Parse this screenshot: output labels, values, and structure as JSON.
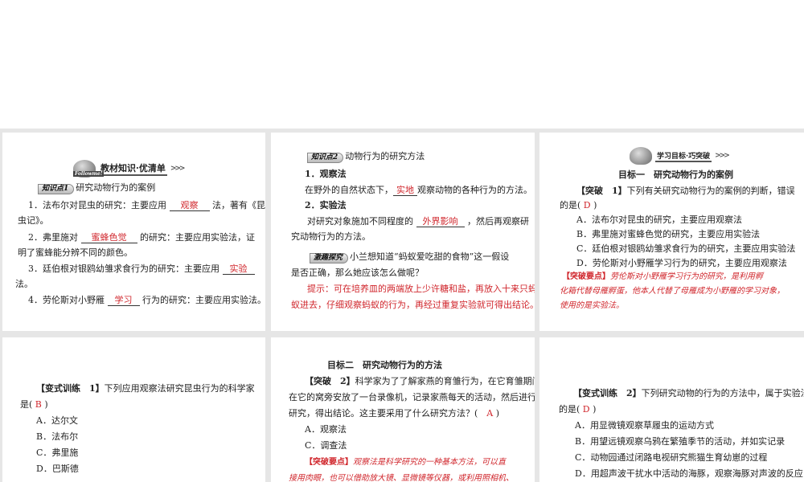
{
  "panel1": {
    "banner_title": "教材知识·优清单",
    "banner_tag": "Followme!",
    "kp_badge": "知识点1",
    "kp_title": "研究动物行为的案例",
    "items": [
      {
        "pre": "1．法布尔对昆虫的研究：主要应用",
        "answer": "观察",
        "post": "法，著有《昆",
        "cont": "虫记》。"
      },
      {
        "pre": "2．弗里施对",
        "answer": "蜜蜂色觉",
        "post": "的研究：主要应用实验法，证",
        "cont": "明了蜜蜂能分辨不同的颜色。"
      },
      {
        "pre": "3．廷伯根对银鸥幼雏求食行为的研究：主要应用",
        "answer": "实验",
        "post": "",
        "cont": "法。"
      },
      {
        "pre": "4．劳伦斯对小野雁",
        "answer": "学习",
        "post": "行为的研究：主要应用实验法。",
        "cont": ""
      }
    ]
  },
  "panel2": {
    "kp_badge": "知识点2",
    "kp_title": "动物行为的研究方法",
    "m1_title": "1．观察法",
    "m1_pre": "在野外的自然状态下，",
    "m1_answer": "实地",
    "m1_post": "观察动物的各种行为的方法。",
    "m2_title": "2．实验法",
    "m2_pre": "对研究对象施加不同程度的",
    "m2_answer": "外界影响",
    "m2_post": "，然后再观察研",
    "m2_cont": "究动物行为的方法。",
    "fun_badge": "激趣探究",
    "fun_q1": "小兰想知道“蚂蚁爱吃甜的食物”这一假设",
    "fun_q2": "是否正确，那么她应该怎么做呢？",
    "hint1": "提示：可在培养皿的两端放上少许糖和盐，再放入十来只蚂",
    "hint2": "蚁进去，仔细观察蚂蚁的行为，再经过重复实验就可得出结论。"
  },
  "panel3": {
    "banner_title": "学习目标·巧突破",
    "goal_title": "目标一　研究动物行为的案例",
    "q_label": "【突破　1】",
    "q1": "下列有关研究动物行为的案例的判断，错误",
    "q2_pre": "的是(",
    "answer": "D",
    "q2_post": ")",
    "options": [
      "A．法布尔对昆虫的研究，主要应用观察法",
      "B．弗里施对蜜蜂色觉的研究，主要应用实验法",
      "C．廷伯根对银鸥幼雏求食行为的研究，主要应用实验法",
      "D．劳伦斯对小野雁学习行为的研究，主要应用观察法"
    ],
    "key_label": "【突破要点】",
    "key1": "劳伦斯对小野雁学习行为的研究，是利用孵",
    "key2": "化箱代替母雁孵蛋，他本人代替了母雁成为小野雁的学习对象，",
    "key3": "使用的是实验法。"
  },
  "panel4": {
    "q_label": "【变式训练　1】",
    "q1": "下列应用观察法研究昆虫行为的科学家",
    "q2_pre": "是(",
    "answer": "B",
    "q2_post": ")",
    "options": [
      "A．达尔文",
      "B．法布尔",
      "C．弗里施",
      "D．巴斯德"
    ]
  },
  "panel5": {
    "goal_title": "目标二　研究动物行为的方法",
    "q_label": "【突破　2】",
    "q1": "科学家为了了解家燕的育雏行为，在它育雏期间，",
    "q2": "在它的窝旁安放了一台录像机，记录家燕每天的活动，然后进行",
    "q3_pre": "研究，得出结论。这主要采用了什么研究方法？(",
    "answer": "A",
    "q3_post": ")",
    "options": [
      "A．观察法",
      "C．调查法"
    ],
    "key_label": "【突破要点】",
    "key1": "观察法是科学研究的一种基本方法，可以直",
    "key2": "接用肉眼，也可以借助放大镜、显微镜等仪器，或利用照相机、"
  },
  "panel6": {
    "q_label": "【变式训练　2】",
    "q1": "下列研究动物的行为的方法中，属于实验法",
    "q2_pre": "的是(",
    "answer": "D",
    "q2_post": ")",
    "options": [
      "A．用显微镜观察草履虫的运动方式",
      "B．用望远镜观察乌鸦在繁殖季节的活动，并如实记录",
      "C．动物园通过闭路电视研究熊猫生育幼崽的过程",
      "D．用超声波干扰水中活动的海豚，观察海豚对声波的反应"
    ]
  }
}
